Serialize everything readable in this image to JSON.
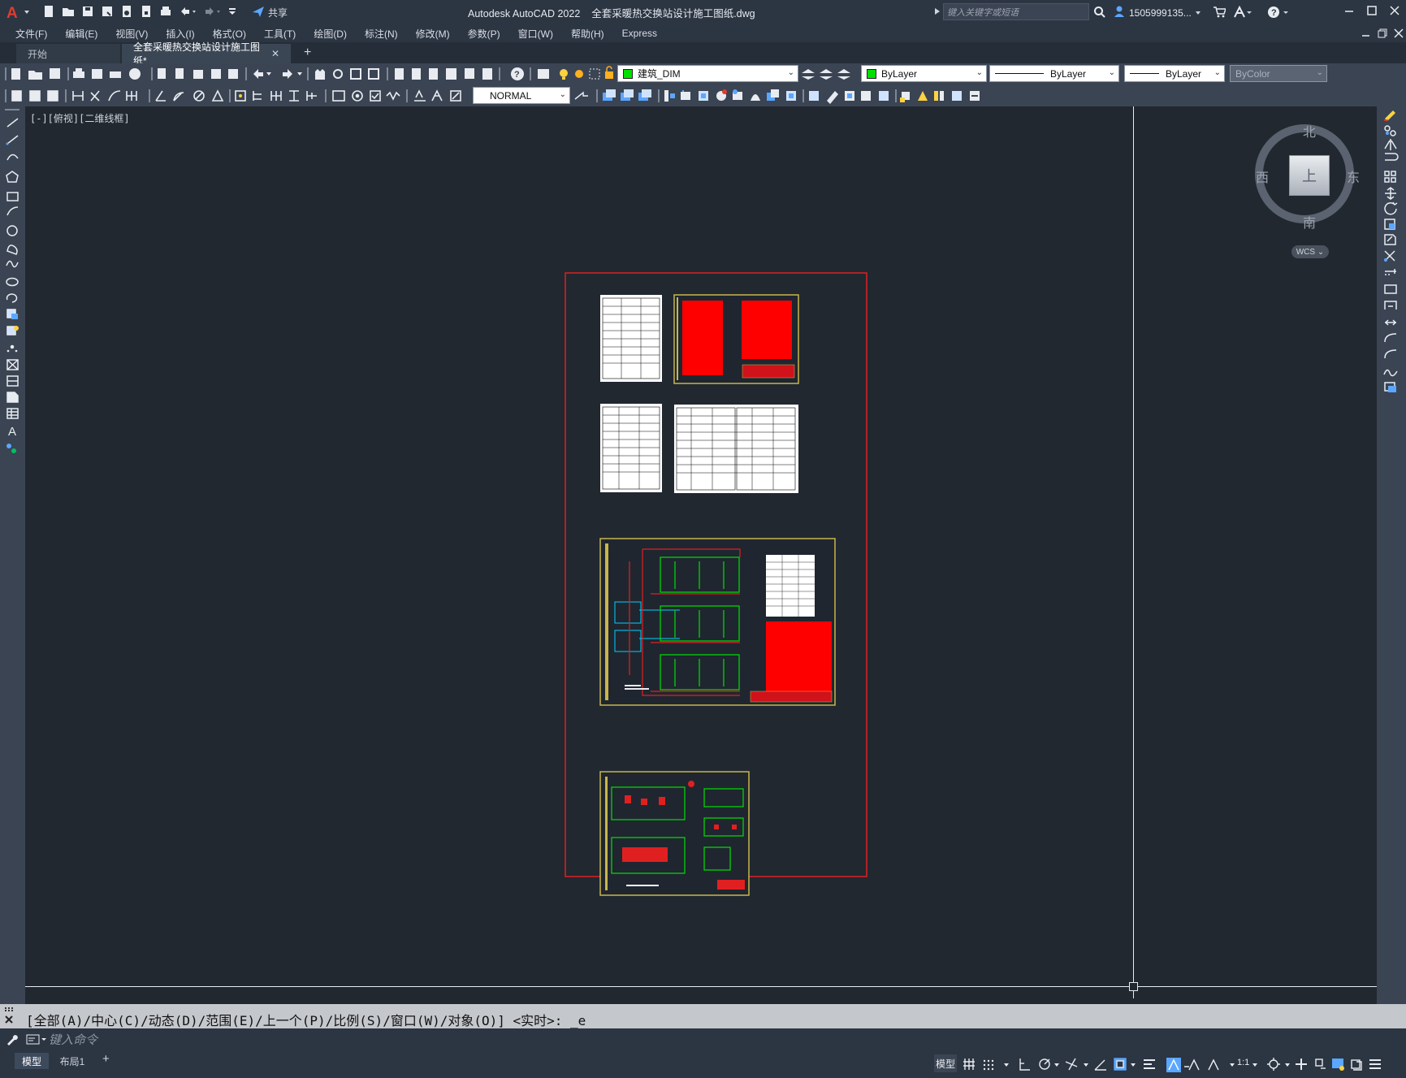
{
  "app": {
    "title": "Autodesk AutoCAD 2022",
    "filename": "全套采暖热交换站设计施工图纸.dwg",
    "share_label": "共享",
    "search_placeholder": "键入关键字或短语",
    "user": "1505999135...",
    "accent_color": "#e23b2e"
  },
  "menu": [
    "文件(F)",
    "编辑(E)",
    "视图(V)",
    "插入(I)",
    "格式(O)",
    "工具(T)",
    "绘图(D)",
    "标注(N)",
    "修改(M)",
    "参数(P)",
    "窗口(W)",
    "帮助(H)",
    "Express"
  ],
  "tabs": {
    "start": "开始",
    "active": "全套采暖热交换站设计施工图纸*",
    "close": "✕",
    "add": "+"
  },
  "toolbar": {
    "layer_name": "建筑_DIM",
    "color": "ByLayer",
    "linetype": "ByLayer",
    "lineweight": "ByLayer",
    "plotstyle": "ByColor",
    "dimstyle": "NORMAL"
  },
  "viewport_label": "[-][俯视][二维线框]",
  "viewcube": {
    "north": "北",
    "south": "南",
    "east": "东",
    "west": "西",
    "top": "上",
    "wcs": "WCS"
  },
  "command": {
    "history": "[全部(A)/中心(C)/动态(D)/范围(E)/上一个(P)/比例(S)/窗口(W)/对象(O)] <实时>: _e",
    "placeholder": "键入命令"
  },
  "layout_tabs": {
    "model": "模型",
    "layout1": "布局1",
    "add": "+"
  },
  "status": {
    "model_label": "模型",
    "scale": "1:1"
  }
}
